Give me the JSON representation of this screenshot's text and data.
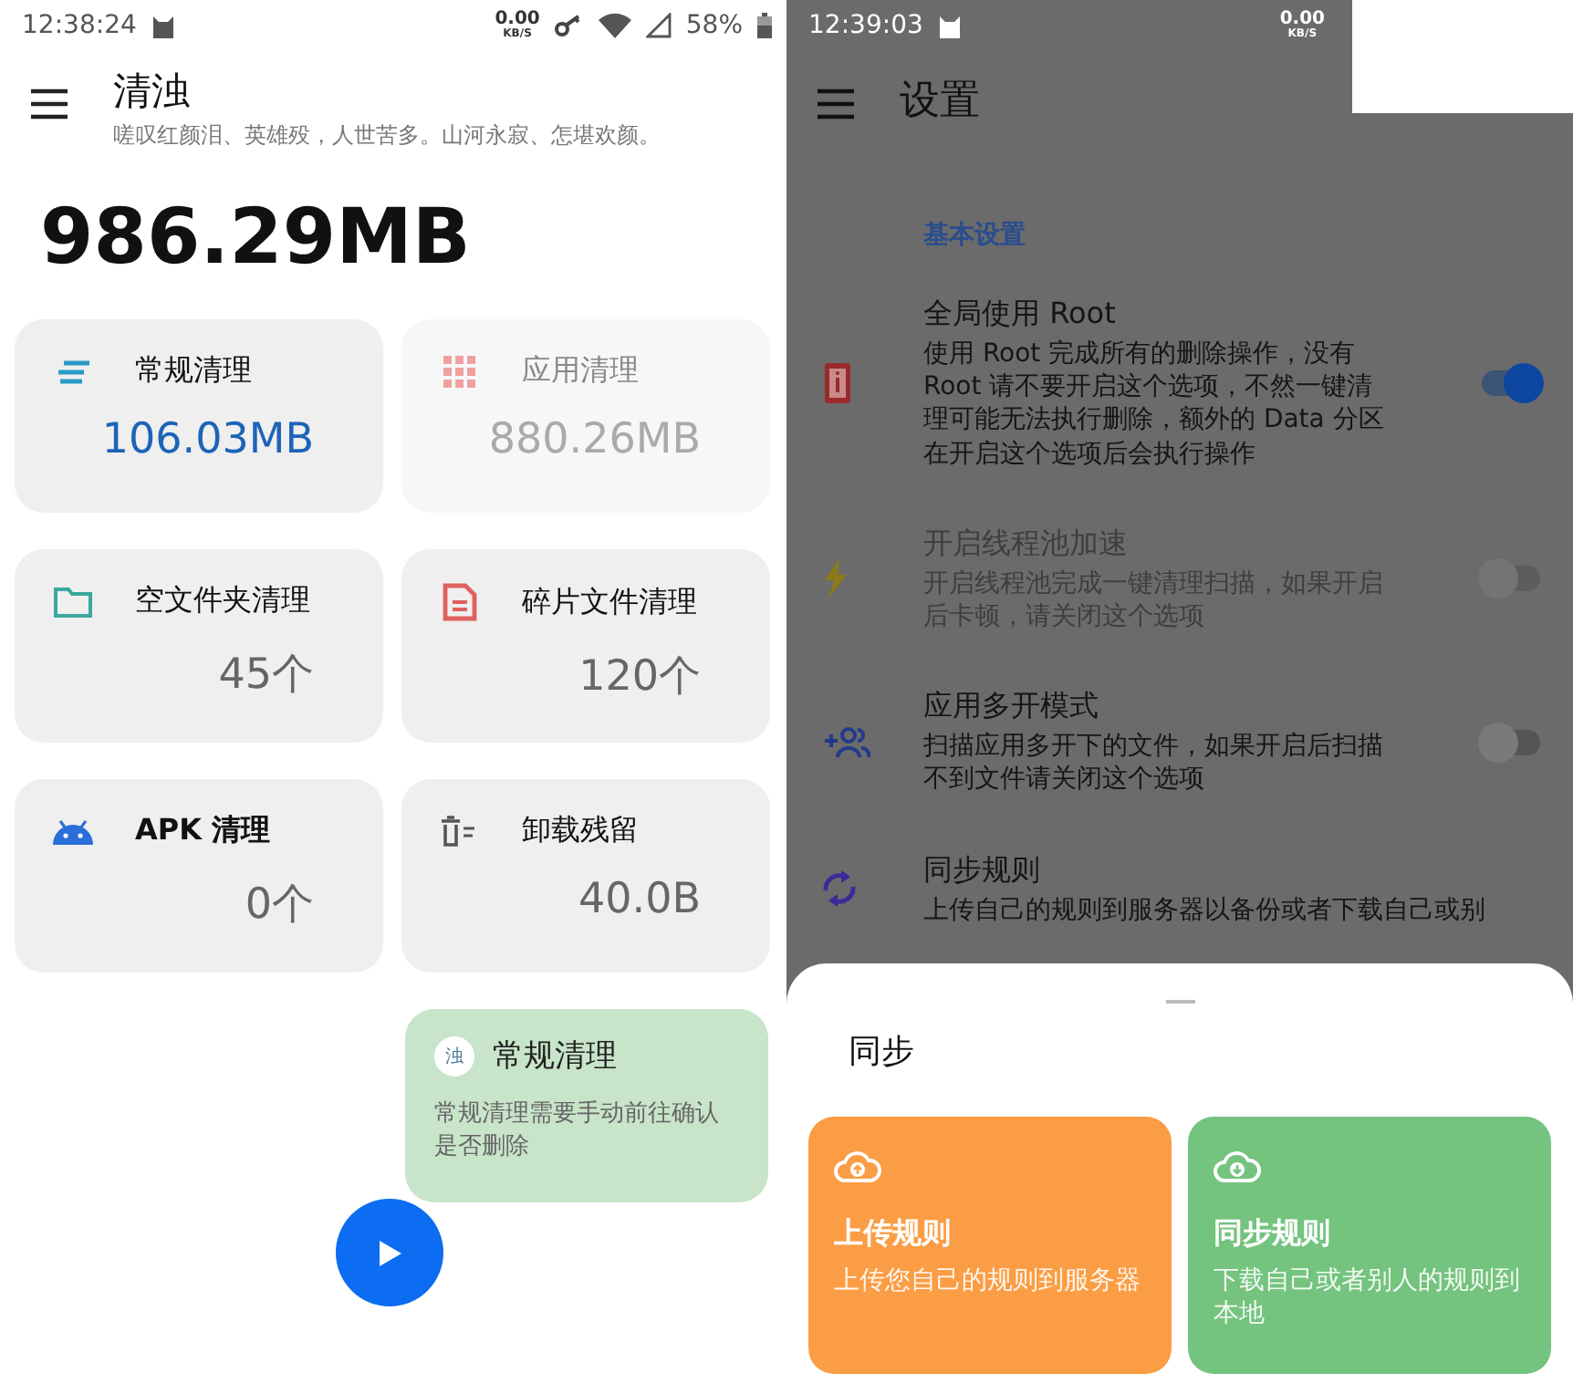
{
  "cleaner_screen": {
    "status_bar": {
      "time": "12:38:24",
      "speed_value": "0.00",
      "speed_unit": "KB/S",
      "battery": "58%"
    },
    "title": "清浊",
    "subtitle": "嗟叹红颜泪、英雄殁，人世苦多。山河永寂、怎堪欢颜。",
    "total": "986.29MB",
    "cards": [
      {
        "title": "常规清理",
        "value": "106.03MB",
        "highlighted": true,
        "disabled": false
      },
      {
        "title": "应用清理",
        "value": "880.26MB",
        "highlighted": false,
        "disabled": true
      },
      {
        "title": "空文件夹清理",
        "value": "45个",
        "highlighted": false,
        "disabled": false
      },
      {
        "title": "碎片文件清理",
        "value": "120个",
        "highlighted": false,
        "disabled": false
      },
      {
        "title": "APK 清理",
        "value": "0个",
        "highlighted": false,
        "disabled": false
      },
      {
        "title": "卸载残留",
        "value": "40.0B",
        "highlighted": false,
        "disabled": false
      }
    ],
    "toast": {
      "badge": "浊",
      "title": "常规清理",
      "message": "常规清理需要手动前往确认是否删除"
    }
  },
  "settings_screen": {
    "status_bar": {
      "time": "12:39:03",
      "speed_value": "0.00",
      "speed_unit": "KB/S"
    },
    "title": "设置",
    "section": "基本设置",
    "items": [
      {
        "kind": "switch",
        "title": "全局使用 Root",
        "description": "使用 Root 完成所有的删除操作，没有 Root 请不要开启这个选项，不然一键清理可能无法执行删除，额外的 Data 分区在开启这个选项后会执行操作",
        "on": true,
        "disabled": false
      },
      {
        "kind": "switch",
        "title": "开启线程池加速",
        "description": "开启线程池完成一键清理扫描，如果开启后卡顿，请关闭这个选项",
        "on": false,
        "disabled": true
      },
      {
        "kind": "switch",
        "title": "应用多开模式",
        "description": "扫描应用多开下的文件，如果开启后扫描不到文件请关闭这个选项",
        "on": false,
        "disabled": false
      },
      {
        "kind": "link",
        "title": "同步规则",
        "description": "上传自己的规则到服务器以备份或者下载自己或别",
        "disabled": false
      }
    ],
    "sheet": {
      "title": "同步",
      "actions": [
        {
          "title": "上传规则",
          "description": "上传您自己的规则到服务器",
          "color": "#fb9d44"
        },
        {
          "title": "同步规则",
          "description": "下载自己或者别人的规则到本地",
          "color": "#74c37f"
        }
      ]
    }
  }
}
